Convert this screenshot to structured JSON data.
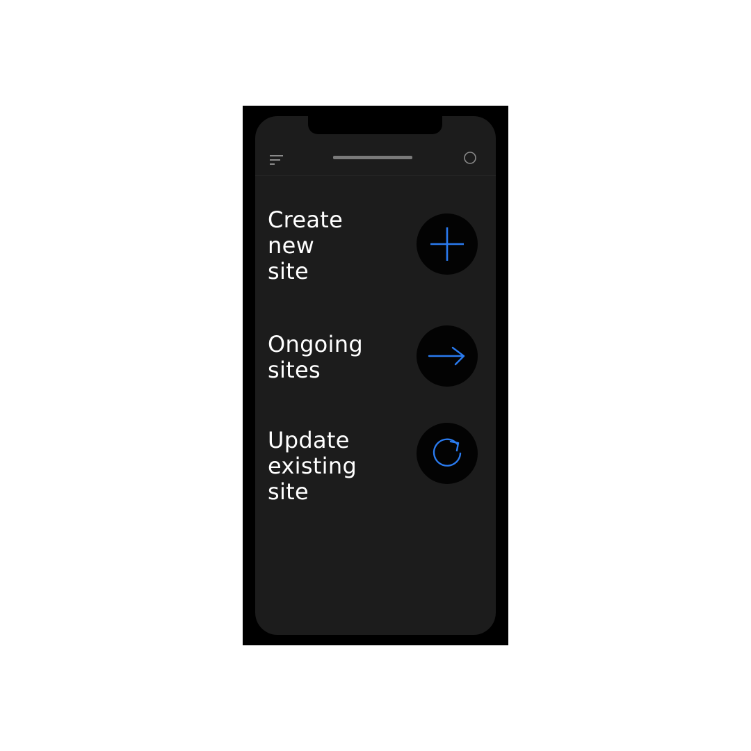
{
  "actions": [
    {
      "label": "Create\nnew\nsite",
      "icon": "plus-icon"
    },
    {
      "label": "Ongoing\nsites",
      "icon": "arrow-right-icon"
    },
    {
      "label": "Update\nexisting\nsite",
      "icon": "refresh-icon"
    }
  ],
  "colors": {
    "screen_background": "#1c1c1c",
    "accent": "#2a7bf0",
    "text": "#ffffff"
  }
}
